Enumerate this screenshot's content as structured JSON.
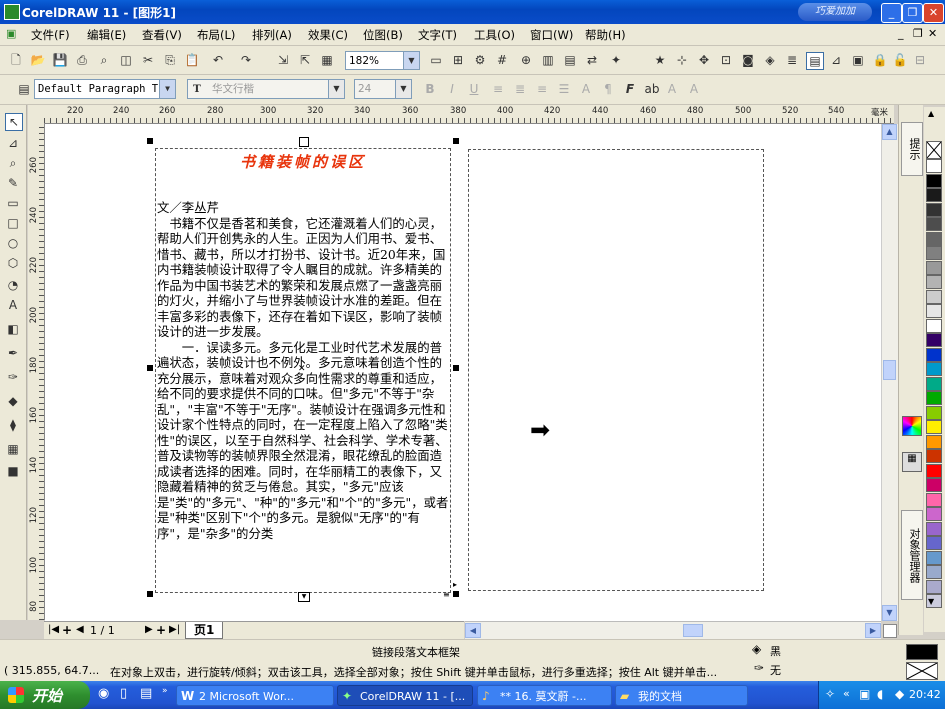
{
  "window": {
    "title": "CorelDRAW 11 - [图形1]",
    "logo_text": "巧爱加加"
  },
  "menu": [
    "文件(F)",
    "编辑(E)",
    "查看(V)",
    "布局(L)",
    "排列(A)",
    "效果(C)",
    "位图(B)",
    "文字(T)",
    "工具(O)",
    "窗口(W)",
    "帮助(H)"
  ],
  "toolbar": {
    "zoom": "182%",
    "style_select": "Default Paragraph T",
    "font": "华文行楷",
    "font_size": "24"
  },
  "ruler": {
    "h_labels": [
      "220",
      "240",
      "260",
      "280",
      "300",
      "320",
      "340",
      "360",
      "380",
      "400",
      "420",
      "440",
      "460",
      "480",
      "500",
      "520",
      "540"
    ],
    "h_unit": "毫米",
    "v_labels": [
      "260",
      "240",
      "220",
      "200",
      "180",
      "160",
      "140",
      "120",
      "100",
      "80"
    ]
  },
  "document": {
    "heading": "书籍装帧的误区",
    "author": "文／李丛芹",
    "paragraphs": [
      "　书籍不仅是香茗和美食，它还灌溉着人们的心灵，帮助人们开创隽永的人生。正因为人们用书、爱书、惜书、藏书，所以才打扮书、设计书。近20年来，国内书籍装帧设计取得了令人瞩目的成就。许多精美的作品为中国书装艺术的繁荣和发展点燃了一盏盏亮丽的灯火，并缩小了与世界装帧设计水准的差距。但在丰富多彩的表像下，还存在着如下误区，影响了装帧设计的进一步发展。",
      "　　一．误读多元。多元化是工业时代艺术发展的普遍状态，装帧设计也不例外。多元意味着创造个性的充分展示，意味着对观众多向性需求的尊重和适应，给不同的要求提供不同的口味。但\"多元\"不等于\"杂乱\"，\"丰富\"不等于\"无序\"。装帧设计在强调多元性和设计家个性特点的同时，在一定程度上陷入了忽略\"类性\"的误区，以至于自然科学、社会科学、学术专著、普及读物等的装帧界限全然混淆，眼花缭乱的脸面造成读者选择的困难。同时，在华丽精工的表像下，又隐藏着精神的贫乏与倦怠。其实，\"多元\"应该是\"类\"的\"多元\"、\"种\"的\"多元\"和\"个\"的\"多元\"，或者是\"种类\"区别下\"个\"的多元。是貌似\"无序\"的\"有序\"，是\"杂多\"的分类"
    ]
  },
  "dock_tabs": {
    "top": "提示",
    "bottom": "对象管理器"
  },
  "page_nav": {
    "page_count": "1 / 1",
    "page_tab": "页1"
  },
  "status": {
    "center": "链接段落文本框架",
    "coords": "( 315.855, 64.7...",
    "hint": "在对象上双击，进行旋转/倾斜；双击该工具，选择全部对象；按住 Shift 键并单击鼠标，进行多重选择；按住 Alt 键并单击...",
    "fill": "黑",
    "outline": "无"
  },
  "taskbar": {
    "start": "开始",
    "tasks": [
      "2 Microsoft Wor...",
      "CorelDRAW 11 - [...",
      "** 16. 莫文蔚 -...",
      "我的文档"
    ],
    "clock": "20:42"
  },
  "colors": {
    "accent": "#e8340c",
    "palette": [
      "#ffffff",
      "#000000",
      "#1a1a1a",
      "#333333",
      "#4d4d4d",
      "#666666",
      "#808080",
      "#999999",
      "#b3b3b3",
      "#cccccc",
      "#e6e6e6",
      "#ffffff",
      "#330066",
      "#0033cc",
      "#0099cc",
      "#00aa88",
      "#00aa00",
      "#88cc00",
      "#ffee00",
      "#ff9900",
      "#cc3300",
      "#ff0000",
      "#cc0066",
      "#ff66aa",
      "#cc66cc",
      "#9966cc",
      "#6666cc",
      "#6699cc",
      "#99aacc",
      "#aaaacc",
      "#ccccdd"
    ]
  }
}
